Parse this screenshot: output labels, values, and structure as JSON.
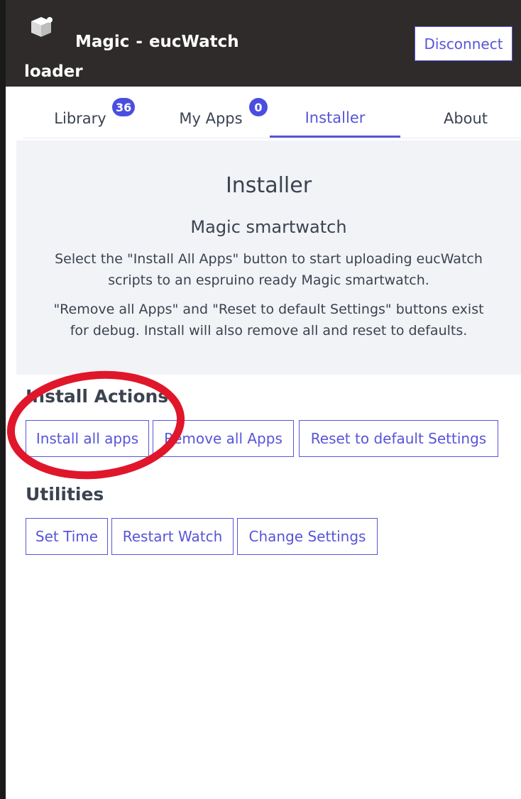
{
  "header": {
    "title": "Magic - eucWatch loader",
    "disconnect_label": "Disconnect"
  },
  "tabs": [
    {
      "label": "Library",
      "badge": "36"
    },
    {
      "label": "My Apps",
      "badge": "0"
    },
    {
      "label": "Installer",
      "active": true
    },
    {
      "label": "About"
    }
  ],
  "installer": {
    "title": "Installer",
    "subtitle": "Magic smartwatch",
    "line1": "Select the \"Install All Apps\" button to start uploading eucWatch",
    "line2": "scripts to an espruino ready Magic smartwatch.",
    "line3": "\"Remove all Apps\" and \"Reset to default Settings\" buttons exist",
    "line4": "for debug. Install will also remove all and reset to defaults."
  },
  "install_actions": {
    "title": "Install Actions",
    "buttons": [
      "Install all apps",
      "Remove all Apps",
      "Reset to default Settings"
    ]
  },
  "utilities": {
    "title": "Utilities",
    "buttons": [
      "Set Time",
      "Restart Watch",
      "Change Settings"
    ]
  },
  "colors": {
    "header_bg": "#2f2b2b",
    "accent": "#5755d9",
    "badge": "#4a4ee0",
    "panel_bg": "#f2f3f6",
    "annotation": "#e0162b"
  },
  "icons": {
    "logo": "cube-logo-icon"
  }
}
